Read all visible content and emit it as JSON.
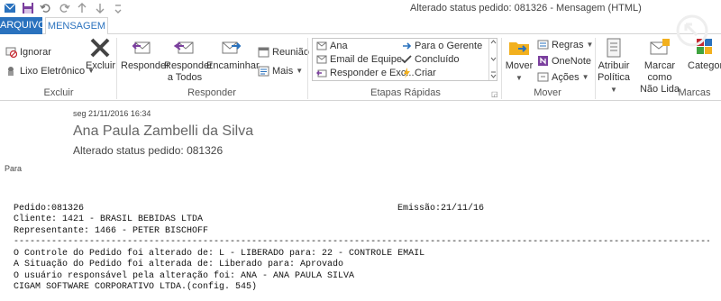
{
  "window": {
    "title": "Alterado status pedido: 081326 - Mensagem (HTML)"
  },
  "tabs": {
    "file": "ARQUIVO",
    "message": "MENSAGEM"
  },
  "ribbon": {
    "delete_group": {
      "label": "Excluir",
      "ignore": "Ignorar",
      "junk": "Lixo Eletrônico",
      "delete": "Excluir"
    },
    "respond_group": {
      "label": "Responder",
      "reply": "Responder",
      "reply_all_1": "Responder",
      "reply_all_2": "a Todos",
      "forward": "Encaminhar",
      "meeting": "Reunião",
      "more": "Mais"
    },
    "quick_steps": {
      "label": "Etapas Rápidas",
      "items": [
        "Ana",
        "Email de Equipe",
        "Responder e Exc...",
        "Para o Gerente",
        "Concluído",
        "Criar"
      ]
    },
    "move_group": {
      "label": "Mover",
      "move": "Mover",
      "rules": "Regras",
      "onenote": "OneNote",
      "actions": "Ações"
    },
    "tags_group": {
      "label": "Marcas",
      "policy_1": "Atribuir",
      "policy_2": "Política",
      "unread_1": "Marcar como",
      "unread_2": "Não Lida",
      "categorize": "Categori"
    }
  },
  "header": {
    "date": "seg 21/11/2016 16:34",
    "sender": "Ana Paula Zambelli da Silva",
    "subject": "Alterado status pedido: 081326",
    "to_label": "Para"
  },
  "message_body": {
    "order": "Pedido:081326",
    "issue_date": "Emissão:21/11/16",
    "client": "Cliente: 1421 - BRASIL BEBIDAS LTDA",
    "rep": "Representante: 1466 - PETER BISCHOFF",
    "separator": "----------------------------------------------------------------------------------------------------------------------------------------",
    "line1": "O Controle do Pedido foi alterado de: L - LIBERADO para: 22 - CONTROLE EMAIL",
    "line2": "A Situação do Pedido foi alterada de: Liberado para: Aprovado",
    "line3": "O usuário responsável pela alteração foi: ANA - ANA PAULA SILVA",
    "line4": "CIGAM SOFTWARE CORPORATIVO LTDA.(config. 545)"
  },
  "colors": {
    "accent": "#2a72be",
    "file_tab": "#2a72be"
  }
}
